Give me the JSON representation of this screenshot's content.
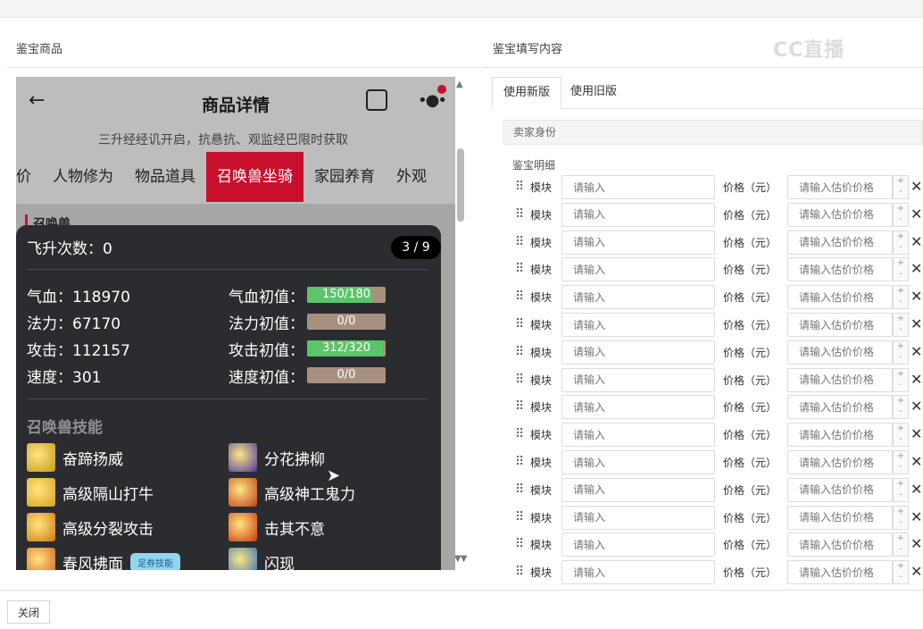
{
  "left_title": "鉴宝商品",
  "right_title": "鉴宝填写内容",
  "watermark": "CC直播",
  "phone": {
    "title": "商品详情",
    "back_icon": "arrow-left-icon",
    "strip_text": "三升经经讥开启，抗悬抗、观监经巴限时获取",
    "tabs": [
      "价",
      "人物修为",
      "物品道具",
      "召唤兽坐骑",
      "家园养育",
      "外观"
    ],
    "active_tab": "召唤兽坐骑",
    "below_text": "召唤兽",
    "popup": {
      "fly_label": "飞升次数：0",
      "page": "3 / 9",
      "stats": [
        {
          "label": "气血：118970",
          "init_label": "气血初值：",
          "bar": "150/180",
          "ratio": 0.83
        },
        {
          "label": "法力：67170",
          "init_label": "法力初值：",
          "bar": "0/0",
          "ratio": 0
        },
        {
          "label": "攻击：112157",
          "init_label": "攻击初值：",
          "bar": "312/320",
          "ratio": 0.97
        },
        {
          "label": "速度：301",
          "init_label": "速度初值：",
          "bar": "0/0",
          "ratio": 0
        }
      ],
      "skills_title": "召唤兽技能",
      "skills": [
        {
          "name": "奋蹄扬威",
          "color": "#c89a1a"
        },
        {
          "name": "分花拂柳",
          "color": "#4a3aa0"
        },
        {
          "name": "高级隔山打牛",
          "color": "#d8a21e"
        },
        {
          "name": "高级神工鬼力",
          "color": "#c0401a"
        },
        {
          "name": "高级分裂攻击",
          "color": "#d07a10"
        },
        {
          "name": "击其不意",
          "color": "#c83a10"
        },
        {
          "name": "春风拂面",
          "color": "#d06020"
        },
        {
          "name": "闪现",
          "color": "#3070c0"
        }
      ],
      "skill_tag": "足券技能"
    }
  },
  "form": {
    "tabs": [
      "使用新版",
      "使用旧版"
    ],
    "seller_label": "卖家身份",
    "detail_label": "鉴宝明细",
    "row_label": "模块",
    "row_placeholder": "请输入",
    "price_label": "价格（元）",
    "price_placeholder": "请输入估价价格",
    "rows": 15
  },
  "close_label": "关闭"
}
